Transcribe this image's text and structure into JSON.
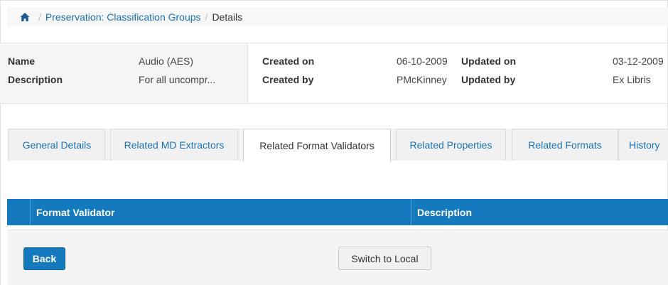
{
  "breadcrumb": {
    "home_icon": "home-icon",
    "separator": "/",
    "link_label": "Preservation: Classification Groups",
    "current": "Details"
  },
  "info": {
    "name_label": "Name",
    "name_value": "Audio (AES)",
    "description_label": "Description",
    "description_value": "For all uncompr...",
    "created_on_label": "Created on",
    "created_on_value": "06-10-2009",
    "created_by_label": "Created by",
    "created_by_value": "PMcKinney",
    "updated_on_label": "Updated on",
    "updated_on_value": "03-12-2009",
    "updated_by_label": "Updated by",
    "updated_by_value": "Ex Libris"
  },
  "tabs": [
    {
      "label": "General Details"
    },
    {
      "label": "Related MD Extractors"
    },
    {
      "label": "Related Format Validators"
    },
    {
      "label": "Related Properties"
    },
    {
      "label": "Related Formats"
    },
    {
      "label": "History"
    }
  ],
  "active_tab": "Related Format Validators",
  "table": {
    "columns": [
      "Format Validator",
      "Description"
    ]
  },
  "footer": {
    "back_label": "Back",
    "switch_label": "Switch to Local"
  },
  "colors": {
    "accent": "#1479bd",
    "link": "#1a72b8"
  }
}
